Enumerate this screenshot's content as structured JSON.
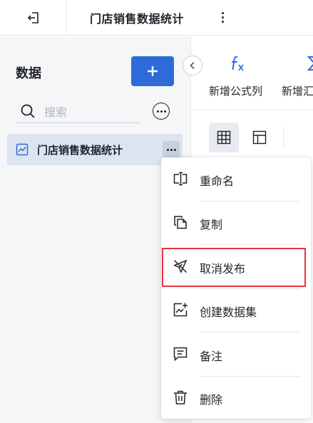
{
  "header": {
    "title": "门店销售数据统计"
  },
  "sidebar": {
    "heading": "数据",
    "search_placeholder": "搜索",
    "items": [
      {
        "label": "门店销售数据统计"
      }
    ]
  },
  "toolbar": {
    "tools": [
      {
        "label": "新增公式列"
      },
      {
        "label": "新增汇"
      }
    ]
  },
  "context_menu": {
    "items": [
      {
        "label": "重命名",
        "icon": "rename-icon"
      },
      {
        "label": "复制",
        "icon": "copy-icon"
      },
      {
        "label": "取消发布",
        "icon": "unpublish-icon"
      },
      {
        "label": "创建数据集",
        "icon": "create-dataset-icon"
      },
      {
        "label": "备注",
        "icon": "note-icon"
      },
      {
        "label": "删除",
        "icon": "delete-icon"
      }
    ],
    "highlighted_item": "取消发布"
  },
  "colors": {
    "accent": "#2e6bd9",
    "selected_item_bg": "#dde4f1",
    "highlight_border": "#e8333b"
  }
}
